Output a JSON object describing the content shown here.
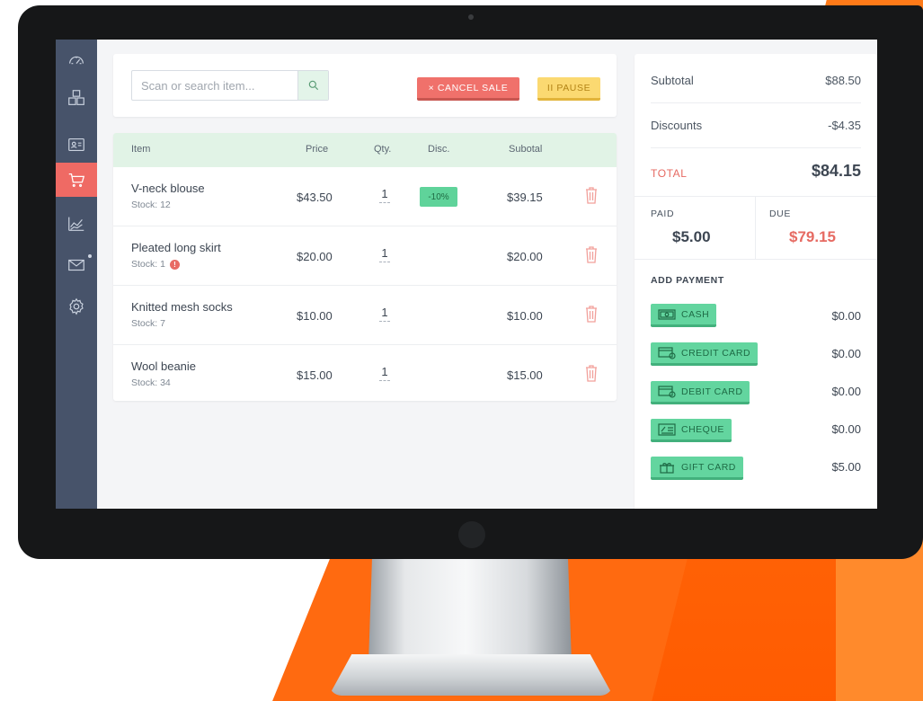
{
  "colors": {
    "brand_orange": "#ff6a10",
    "sidebar": "#47536a",
    "active_nav": "#ef6a64",
    "accent_green": "#63d59f",
    "danger": "#f0716b",
    "warning": "#fbd971",
    "total_red": "#e66a62"
  },
  "sidebar": {
    "items": [
      {
        "icon": "dashboard-icon",
        "active": false
      },
      {
        "icon": "inventory-boxes-icon",
        "active": false
      },
      {
        "icon": "customers-card-icon",
        "active": false
      },
      {
        "icon": "cart-icon",
        "active": true
      },
      {
        "icon": "reports-chart-icon",
        "active": false
      },
      {
        "icon": "mail-icon",
        "active": false,
        "has_notification": true
      },
      {
        "icon": "settings-gear-icon",
        "active": false
      }
    ]
  },
  "search": {
    "placeholder": "Scan or search item...",
    "icon": "search-icon"
  },
  "actions": {
    "cancel_label": "× CANCEL SALE",
    "pause_label": "II PAUSE"
  },
  "table": {
    "headers": {
      "item": "Item",
      "price": "Price",
      "qty": "Qty.",
      "disc": "Disc.",
      "subtotal": "Subotal"
    },
    "rows": [
      {
        "name": "V-neck blouse",
        "stock": "Stock: 12",
        "price": "$43.50",
        "qty": "1",
        "disc": "-10%",
        "subtotal": "$39.15",
        "low_stock": false
      },
      {
        "name": "Pleated long skirt",
        "stock": "Stock: 1",
        "price": "$20.00",
        "qty": "1",
        "disc": "",
        "subtotal": "$20.00",
        "low_stock": true
      },
      {
        "name": "Knitted mesh socks",
        "stock": "Stock: 7",
        "price": "$10.00",
        "qty": "1",
        "disc": "",
        "subtotal": "$10.00",
        "low_stock": false
      },
      {
        "name": "Wool beanie",
        "stock": "Stock: 34",
        "price": "$15.00",
        "qty": "1",
        "disc": "",
        "subtotal": "$15.00",
        "low_stock": false
      }
    ]
  },
  "totals": {
    "subtotal_label": "Subtotal",
    "subtotal_value": "$88.50",
    "discounts_label": "Discounts",
    "discounts_value": "-$4.35",
    "total_label": "TOTAL",
    "total_value": "$84.15",
    "paid_label": "PAID",
    "paid_value": "$5.00",
    "due_label": "DUE",
    "due_value": "$79.15"
  },
  "payments": {
    "heading": "ADD PAYMENT",
    "methods": [
      {
        "label": "CASH",
        "icon": "cash-icon",
        "amount": "$0.00"
      },
      {
        "label": "CREDIT CARD",
        "icon": "credit-card-icon",
        "amount": "$0.00"
      },
      {
        "label": "DEBIT CARD",
        "icon": "debit-card-icon",
        "amount": "$0.00"
      },
      {
        "label": "CHEQUE",
        "icon": "cheque-icon",
        "amount": "$0.00"
      },
      {
        "label": "GIFT CARD",
        "icon": "gift-card-icon",
        "amount": "$5.00"
      }
    ]
  }
}
